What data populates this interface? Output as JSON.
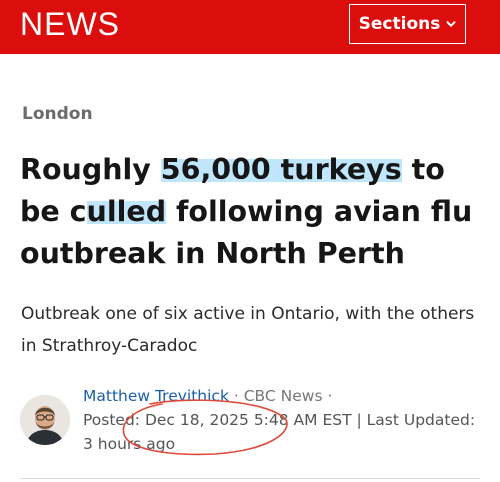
{
  "header": {
    "logo": "NEWS",
    "sections_label": "Sections",
    "brand_color": "#dc0d0d"
  },
  "article": {
    "kicker": "London",
    "headline": {
      "p1": "Roughly ",
      "h1": "56,000 turkeys",
      "p2": " to be c",
      "h2": "ulled",
      "p3": " following avian flu outbreak in North Perth"
    },
    "dek": "Outbreak one of six active in Ontario, with the others in Strathroy-Caradoc",
    "byline": {
      "author": "Matthew Trevithick",
      "outlet": " · CBC News ·",
      "posted": "Posted: Dec 18, 2025 5:48 AM EST | Last Updated: 3 hours ago"
    },
    "highlight_color": "#bfe6fb",
    "annotation_color": "#e04a3a"
  },
  "icons": {
    "sections_chevron": "chevron-down-icon"
  }
}
